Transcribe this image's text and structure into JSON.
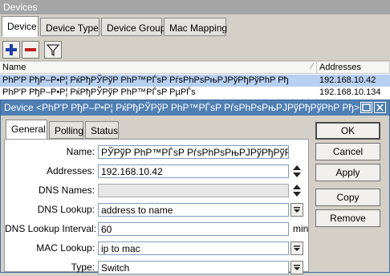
{
  "window": {
    "title": "Devices"
  },
  "tabs": [
    {
      "label": "Device"
    },
    {
      "label": "Device Type"
    },
    {
      "label": "Device Group"
    },
    {
      "label": "Mac Mapping"
    }
  ],
  "list": {
    "columns": {
      "name": "Name",
      "addresses": "Addresses"
    },
    "rows": [
      {
        "name": "PhP'P PђP–P•P¦ PќPђPЎPўP PhP™PЃsP PѓsPhPѕPњPJPўPђPўPhP Pђ",
        "address": "192.168.10.42"
      },
      {
        "name": "PhP'P PђP–P•P¦ PќPђPЎPўP PhP™PЃsP PµPЃs",
        "address": "192.168.10.134"
      }
    ]
  },
  "dialog": {
    "title": "Device <PhP'P PђP–P•P¦ PќPђPЎPўP PhP™PЃsP PѓsPhPѕPњPJPўPђPўPhP Pђ>",
    "tabs": [
      {
        "label": "General"
      },
      {
        "label": "Polling"
      },
      {
        "label": "Status"
      }
    ],
    "fields": {
      "name": {
        "label": "Name:",
        "value": "PЎPўP PhP™PЃsP PѓsPhPѕPњPJPўPђPўPhP Pђ"
      },
      "addresses": {
        "label": "Addresses:",
        "value": "192.168.10.42"
      },
      "dns_names": {
        "label": "DNS Names:",
        "value": ""
      },
      "dns_lookup": {
        "label": "DNS Lookup:",
        "value": "address to name"
      },
      "dns_interval": {
        "label": "DNS Lookup Interval:",
        "value": "60",
        "unit": "min"
      },
      "mac_lookup": {
        "label": "MAC Lookup:",
        "value": "ip to mac"
      },
      "type": {
        "label": "Type:",
        "value": "Switch"
      }
    },
    "buttons": {
      "ok": "OK",
      "cancel": "Cancel",
      "apply": "Apply",
      "copy": "Copy",
      "remove": "Remove"
    }
  }
}
